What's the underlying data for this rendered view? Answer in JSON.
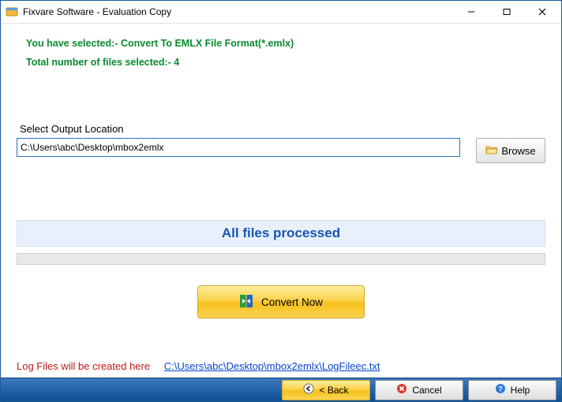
{
  "window": {
    "title": "Fixvare Software - Evaluation Copy"
  },
  "summary": {
    "line1": "You have selected:- Convert To EMLX File Format(*.emlx)",
    "line2": "Total number of files selected:- 4"
  },
  "output": {
    "label": "Select Output Location",
    "path": "C:\\Users\\abc\\Desktop\\mbox2emlx",
    "browse_label": "Browse"
  },
  "status": {
    "message": "All files processed"
  },
  "actions": {
    "convert_label": "Convert Now"
  },
  "log": {
    "label": "Log Files will be created here",
    "link": "C:\\Users\\abc\\Desktop\\mbox2emlx\\LogFileec.txt"
  },
  "footer": {
    "back_label": "< Back",
    "cancel_label": "Cancel",
    "help_label": "Help"
  }
}
